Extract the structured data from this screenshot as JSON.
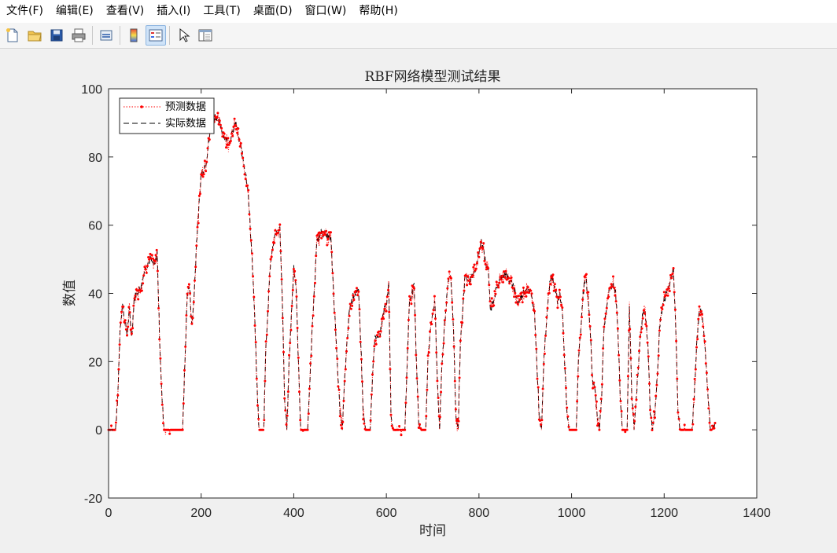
{
  "menu": {
    "items": [
      "文件(F)",
      "编辑(E)",
      "查看(V)",
      "插入(I)",
      "工具(T)",
      "桌面(D)",
      "窗口(W)",
      "帮助(H)"
    ]
  },
  "toolbar": {
    "buttons": [
      "new-file-icon",
      "open-folder-icon",
      "save-icon",
      "print-icon",
      "link-plot-icon",
      "colorbar-icon",
      "legend-icon",
      "pointer-icon",
      "property-editor-icon"
    ]
  },
  "chart_data": {
    "type": "line",
    "title": "RBF网络模型测试结果",
    "xlabel": "时间",
    "ylabel": "数值",
    "xlim": [
      0,
      1400
    ],
    "ylim": [
      -20,
      100
    ],
    "xticks": [
      "0",
      "200",
      "400",
      "600",
      "800",
      "1000",
      "1200",
      "1400"
    ],
    "yticks": [
      "-20",
      "0",
      "20",
      "40",
      "60",
      "80",
      "100"
    ],
    "legend_position": "top-left",
    "grid": false,
    "colors": {
      "predicted": "#ff0000",
      "actual": "#000000"
    },
    "keypoints": [
      [
        0,
        0
      ],
      [
        15,
        0
      ],
      [
        20,
        10
      ],
      [
        25,
        30
      ],
      [
        30,
        37
      ],
      [
        35,
        32
      ],
      [
        40,
        28
      ],
      [
        45,
        35
      ],
      [
        50,
        27
      ],
      [
        55,
        38
      ],
      [
        60,
        40
      ],
      [
        70,
        42
      ],
      [
        80,
        48
      ],
      [
        90,
        50
      ],
      [
        100,
        48
      ],
      [
        105,
        52
      ],
      [
        110,
        28
      ],
      [
        115,
        10
      ],
      [
        120,
        0
      ],
      [
        160,
        0
      ],
      [
        165,
        20
      ],
      [
        170,
        40
      ],
      [
        175,
        42
      ],
      [
        180,
        30
      ],
      [
        185,
        40
      ],
      [
        190,
        55
      ],
      [
        200,
        75
      ],
      [
        210,
        78
      ],
      [
        220,
        88
      ],
      [
        230,
        92
      ],
      [
        240,
        90
      ],
      [
        250,
        86
      ],
      [
        260,
        84
      ],
      [
        270,
        88
      ],
      [
        275,
        90
      ],
      [
        280,
        86
      ],
      [
        290,
        80
      ],
      [
        300,
        72
      ],
      [
        305,
        62
      ],
      [
        310,
        50
      ],
      [
        315,
        35
      ],
      [
        320,
        15
      ],
      [
        325,
        0
      ],
      [
        335,
        0
      ],
      [
        340,
        25
      ],
      [
        350,
        50
      ],
      [
        360,
        57
      ],
      [
        370,
        59
      ],
      [
        375,
        40
      ],
      [
        380,
        10
      ],
      [
        385,
        0
      ],
      [
        390,
        20
      ],
      [
        400,
        48
      ],
      [
        405,
        42
      ],
      [
        410,
        20
      ],
      [
        415,
        0
      ],
      [
        430,
        0
      ],
      [
        440,
        30
      ],
      [
        450,
        55
      ],
      [
        460,
        58
      ],
      [
        470,
        57
      ],
      [
        480,
        56
      ],
      [
        490,
        30
      ],
      [
        500,
        5
      ],
      [
        505,
        0
      ],
      [
        510,
        15
      ],
      [
        520,
        35
      ],
      [
        530,
        40
      ],
      [
        540,
        40
      ],
      [
        545,
        25
      ],
      [
        550,
        5
      ],
      [
        555,
        0
      ],
      [
        565,
        0
      ],
      [
        570,
        15
      ],
      [
        575,
        27
      ],
      [
        585,
        27
      ],
      [
        595,
        35
      ],
      [
        600,
        37
      ],
      [
        605,
        43
      ],
      [
        610,
        5
      ],
      [
        615,
        0
      ],
      [
        640,
        0
      ],
      [
        645,
        20
      ],
      [
        650,
        38
      ],
      [
        660,
        42
      ],
      [
        665,
        20
      ],
      [
        670,
        2
      ],
      [
        675,
        0
      ],
      [
        685,
        0
      ],
      [
        690,
        22
      ],
      [
        700,
        35
      ],
      [
        705,
        37
      ],
      [
        710,
        15
      ],
      [
        715,
        0
      ],
      [
        720,
        20
      ],
      [
        730,
        38
      ],
      [
        735,
        45
      ],
      [
        740,
        44
      ],
      [
        745,
        30
      ],
      [
        750,
        5
      ],
      [
        755,
        0
      ],
      [
        760,
        25
      ],
      [
        770,
        45
      ],
      [
        780,
        44
      ],
      [
        790,
        46
      ],
      [
        800,
        52
      ],
      [
        805,
        55
      ],
      [
        810,
        53
      ],
      [
        815,
        48
      ],
      [
        820,
        47
      ],
      [
        825,
        35
      ],
      [
        835,
        40
      ],
      [
        845,
        44
      ],
      [
        855,
        46
      ],
      [
        865,
        44
      ],
      [
        875,
        42
      ],
      [
        885,
        37
      ],
      [
        895,
        40
      ],
      [
        905,
        42
      ],
      [
        915,
        38
      ],
      [
        920,
        35
      ],
      [
        925,
        20
      ],
      [
        930,
        5
      ],
      [
        935,
        0
      ],
      [
        940,
        20
      ],
      [
        950,
        40
      ],
      [
        955,
        45
      ],
      [
        960,
        44
      ],
      [
        970,
        38
      ],
      [
        975,
        40
      ],
      [
        980,
        35
      ],
      [
        985,
        20
      ],
      [
        990,
        5
      ],
      [
        995,
        0
      ],
      [
        1010,
        0
      ],
      [
        1015,
        20
      ],
      [
        1025,
        40
      ],
      [
        1030,
        45
      ],
      [
        1035,
        40
      ],
      [
        1040,
        30
      ],
      [
        1045,
        15
      ],
      [
        1050,
        12
      ],
      [
        1055,
        5
      ],
      [
        1060,
        0
      ],
      [
        1065,
        10
      ],
      [
        1070,
        30
      ],
      [
        1080,
        40
      ],
      [
        1090,
        43
      ],
      [
        1095,
        40
      ],
      [
        1100,
        30
      ],
      [
        1105,
        10
      ],
      [
        1110,
        0
      ],
      [
        1120,
        0
      ],
      [
        1125,
        37
      ],
      [
        1130,
        10
      ],
      [
        1135,
        0
      ],
      [
        1140,
        10
      ],
      [
        1145,
        20
      ],
      [
        1150,
        30
      ],
      [
        1155,
        35
      ],
      [
        1160,
        33
      ],
      [
        1165,
        25
      ],
      [
        1170,
        5
      ],
      [
        1175,
        0
      ],
      [
        1180,
        5
      ],
      [
        1185,
        15
      ],
      [
        1190,
        30
      ],
      [
        1195,
        35
      ],
      [
        1200,
        38
      ],
      [
        1205,
        40
      ],
      [
        1210,
        42
      ],
      [
        1215,
        45
      ],
      [
        1220,
        47
      ],
      [
        1225,
        30
      ],
      [
        1230,
        5
      ],
      [
        1235,
        0
      ],
      [
        1260,
        0
      ],
      [
        1265,
        10
      ],
      [
        1270,
        25
      ],
      [
        1275,
        33
      ],
      [
        1280,
        36
      ],
      [
        1285,
        30
      ],
      [
        1290,
        20
      ],
      [
        1295,
        10
      ],
      [
        1300,
        0
      ],
      [
        1305,
        0
      ],
      [
        1310,
        2
      ]
    ],
    "series": [
      {
        "name": "预测数据",
        "style": "red dotted line with point markers"
      },
      {
        "name": "实际数据",
        "style": "black dashed line"
      }
    ]
  }
}
